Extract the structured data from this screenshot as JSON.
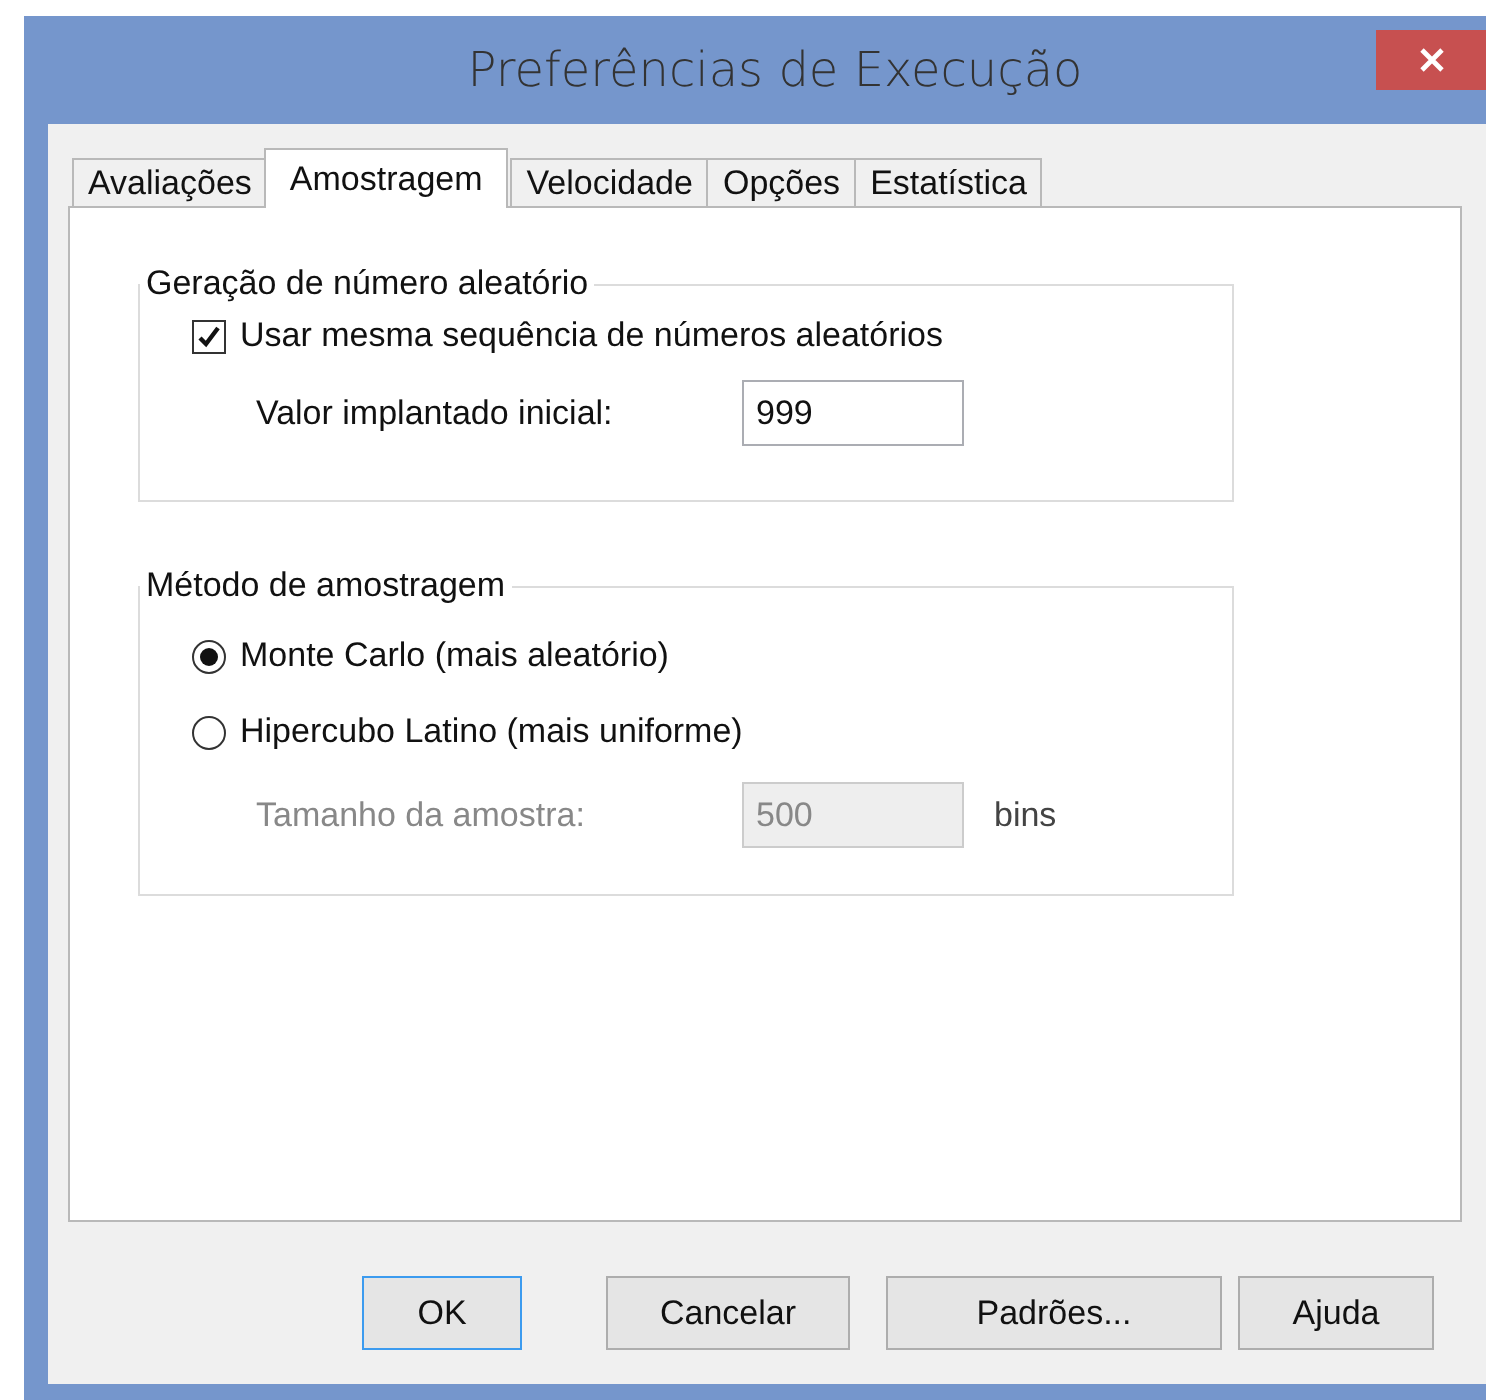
{
  "window": {
    "title": "Preferências de Execução"
  },
  "tabs": [
    {
      "label": "Avaliações",
      "selected": false
    },
    {
      "label": "Amostragem",
      "selected": true
    },
    {
      "label": "Velocidade",
      "selected": false
    },
    {
      "label": "Opções",
      "selected": false
    },
    {
      "label": "Estatística",
      "selected": false
    }
  ],
  "random_group": {
    "title": "Geração de número aleatório",
    "checkbox": {
      "label": "Usar mesma sequência de números aleatórios",
      "checked": true
    },
    "seed": {
      "label": "Valor implantado inicial:",
      "value": "999",
      "disabled": false
    }
  },
  "sampling_group": {
    "title": "Método de amostragem",
    "options": [
      {
        "label": "Monte Carlo  (mais aleatório)",
        "selected": true
      },
      {
        "label": "Hipercubo Latino  (mais uniforme)",
        "selected": false
      }
    ],
    "size": {
      "label": "Tamanho da amostra:",
      "value": "500",
      "unit": "bins",
      "disabled": true
    }
  },
  "buttons": [
    {
      "label": "OK",
      "default": true
    },
    {
      "label": "Cancelar",
      "default": false
    },
    {
      "label": "Padrões...",
      "default": false
    },
    {
      "label": "Ajuda",
      "default": false
    }
  ]
}
